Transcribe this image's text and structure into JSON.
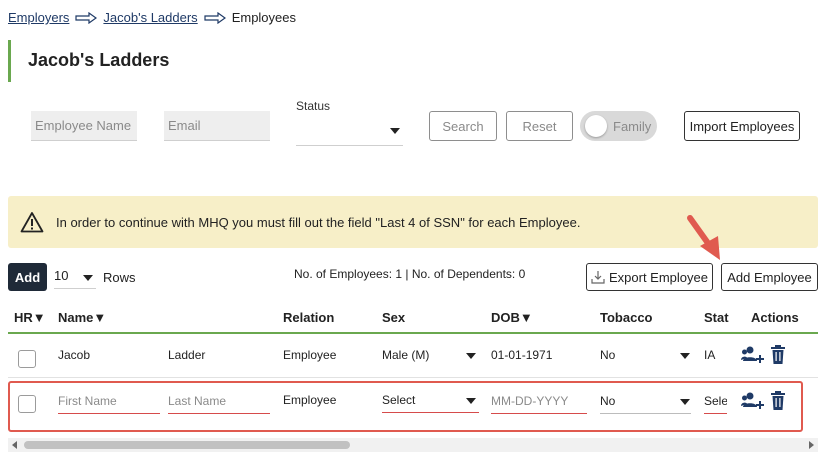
{
  "breadcrumb": {
    "items": [
      "Employers",
      "Jacob's Ladders"
    ],
    "current": "Employees"
  },
  "page": {
    "title": "Jacob's Ladders"
  },
  "filters": {
    "employee_name_placeholder": "Employee Name",
    "email_placeholder": "Email",
    "status_label": "Status",
    "status_value": "",
    "search_label": "Search",
    "reset_label": "Reset",
    "family_label": "Family",
    "import_label": "Import Employees"
  },
  "warning": {
    "text": "In order to continue with MHQ you must fill out the field \"Last 4 of SSN\" for each Employee."
  },
  "controls": {
    "add_label": "Add",
    "rows_value": "10",
    "rows_label": "Rows",
    "counts_text": "No. of Employees: 1 | No. of Dependents: 0",
    "export_label": "Export Employee",
    "add_employee_label": "Add Employee"
  },
  "table": {
    "headers": {
      "hr": "HR▼",
      "name": "Name▼",
      "relation": "Relation",
      "sex": "Sex",
      "dob": "DOB▼",
      "tobacco": "Tobacco",
      "state": "Stat",
      "actions": "Actions"
    },
    "rows": [
      {
        "first": "Jacob",
        "last": "Ladder",
        "relation": "Employee",
        "sex": "Male (M)",
        "dob": "01-01-1971",
        "tobacco": "No",
        "state": "IA"
      }
    ],
    "new_row": {
      "first_placeholder": "First Name",
      "last_placeholder": "Last Name",
      "relation": "Employee",
      "sex": "Select",
      "dob_placeholder": "MM-DD-YYYY",
      "tobacco": "No",
      "state": "Selec"
    }
  },
  "colors": {
    "accent_green": "#6aa84f",
    "warning_bg": "#f7efc8",
    "annotation_red": "#e05a4f",
    "add_button_bg": "#1f2a38",
    "action_icon": "#1f3a66"
  }
}
